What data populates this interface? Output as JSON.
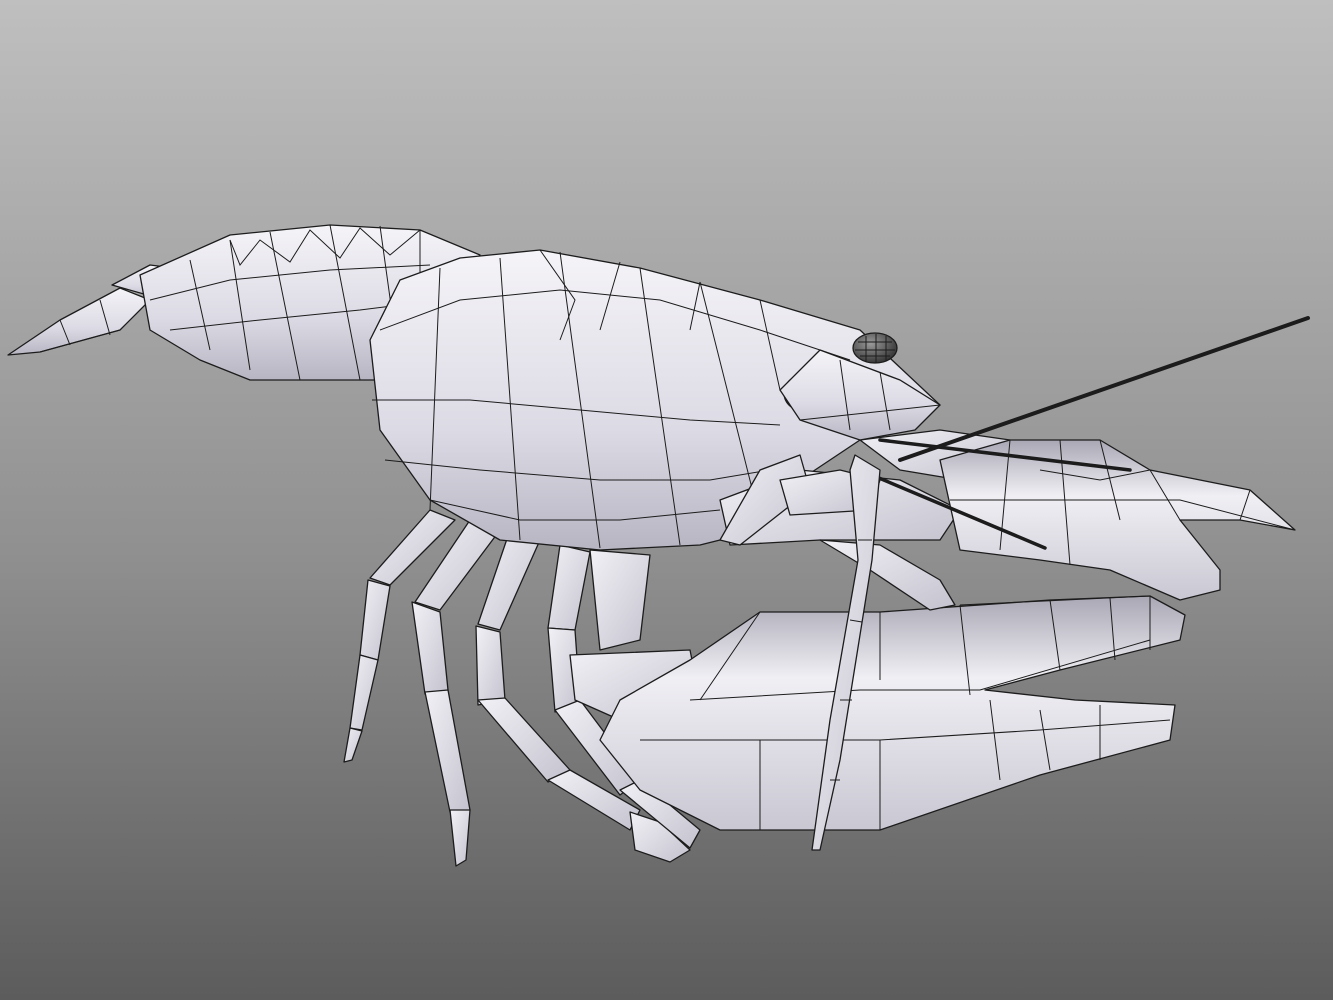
{
  "render": {
    "subject": "crayfish-wireframe-model",
    "background_top": "#bdbdbd",
    "background_bottom": "#5f5f5f",
    "shade_light": "#f3f2f6",
    "shade_mid": "#d3d1dc",
    "shade_dark": "#a5a3b0",
    "edge_color": "#1c1c1c"
  }
}
